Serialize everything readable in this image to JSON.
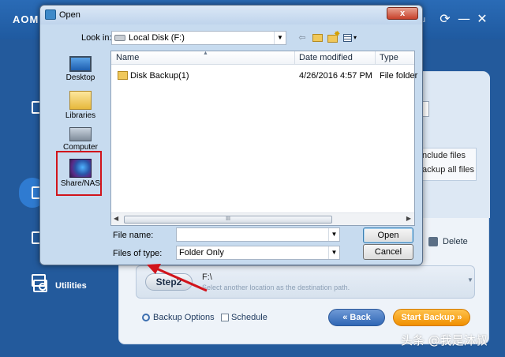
{
  "app": {
    "title": "AOMEI",
    "title_suffix": "u",
    "refresh_glyph": "⟳",
    "minimize_glyph": "—",
    "close_glyph": "✕",
    "sidebar": {
      "utilities_label": "Utilities"
    },
    "options": {
      "include_files": "nclude files",
      "backup_all_files": "ackup all files"
    },
    "delete_label": "Delete",
    "step2": {
      "label": "Step2",
      "path": "F:\\",
      "hint": "Select another location as the destination path."
    },
    "backup_options_label": "Backup Options",
    "schedule_label": "Schedule",
    "back_button": "« Back",
    "start_button": "Start Backup »",
    "colors": {
      "titlebar": "#2a6bb6",
      "start_button": "#f08f00",
      "back_button": "#2f66b5"
    }
  },
  "dialog": {
    "title": "Open",
    "close_glyph": "x",
    "look_in_label": "Look in:",
    "look_in_value": "Local Disk (F:)",
    "toolbar": {
      "back_glyph": "⇦",
      "view_glyph": "▾"
    },
    "places": [
      {
        "label": "Desktop",
        "icon": "desktop-icon"
      },
      {
        "label": "Libraries",
        "icon": "libraries-icon"
      },
      {
        "label": "Computer",
        "icon": "computer-icon"
      },
      {
        "label": "Share/NAS",
        "icon": "share-nas-icon"
      }
    ],
    "columns": {
      "name": "Name",
      "date": "Date modified",
      "type": "Type"
    },
    "rows": [
      {
        "name": "Disk Backup(1)",
        "date": "4/26/2016 4:57 PM",
        "type": "File folder"
      }
    ],
    "scroll_thumb_glyph": "III",
    "file_name_label": "File name:",
    "file_name_value": "",
    "files_of_type_label": "Files of type:",
    "files_of_type_value": "Folder Only",
    "open_button": "Open",
    "cancel_button": "Cancel",
    "highlight_color": "#d1141b"
  },
  "watermark": "头条 @我是沐叔"
}
